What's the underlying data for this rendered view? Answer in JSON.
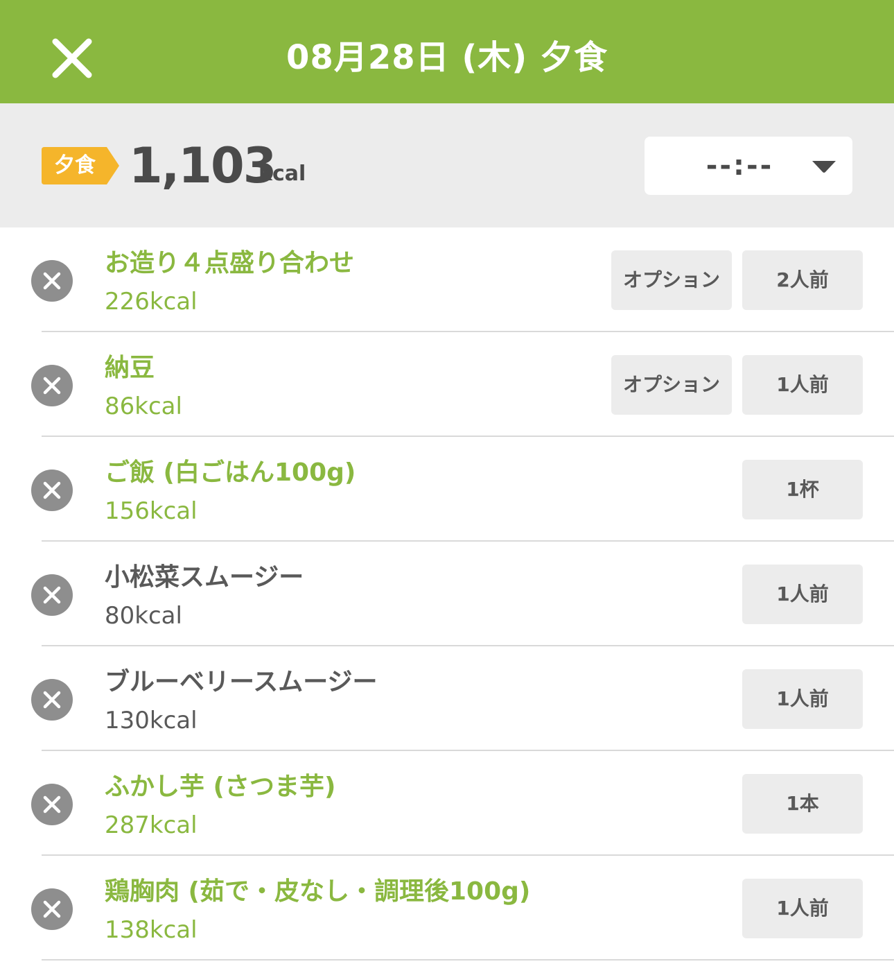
{
  "header": {
    "title": "08月28日 (木) 夕食",
    "close_icon": "close-icon"
  },
  "summary": {
    "meal_tag": "夕食",
    "total_kcal": "1,103",
    "kcal_unit": "kcal",
    "time_value": "--:--",
    "colors": {
      "tag": "#f5b52b",
      "header": "#8ab840"
    }
  },
  "items": [
    {
      "name": "お造り４点盛り合わせ",
      "kcal": "226kcal",
      "option": "オプション",
      "qty": "2人前",
      "style": "green"
    },
    {
      "name": "納豆",
      "kcal": "86kcal",
      "option": "オプション",
      "qty": "1人前",
      "style": "green"
    },
    {
      "name": "ご飯 (白ごはん100g)",
      "kcal": "156kcal",
      "option": null,
      "qty": "1杯",
      "style": "green"
    },
    {
      "name": "小松菜スムージー",
      "kcal": "80kcal",
      "option": null,
      "qty": "1人前",
      "style": "gray"
    },
    {
      "name": "ブルーベリースムージー",
      "kcal": "130kcal",
      "option": null,
      "qty": "1人前",
      "style": "gray"
    },
    {
      "name": "ふかし芋 (さつま芋)",
      "kcal": "287kcal",
      "option": null,
      "qty": "1本",
      "style": "green"
    },
    {
      "name": "鶏胸肉 (茹で・皮なし・調理後100g)",
      "kcal": "138kcal",
      "option": null,
      "qty": "1人前",
      "style": "green"
    }
  ]
}
